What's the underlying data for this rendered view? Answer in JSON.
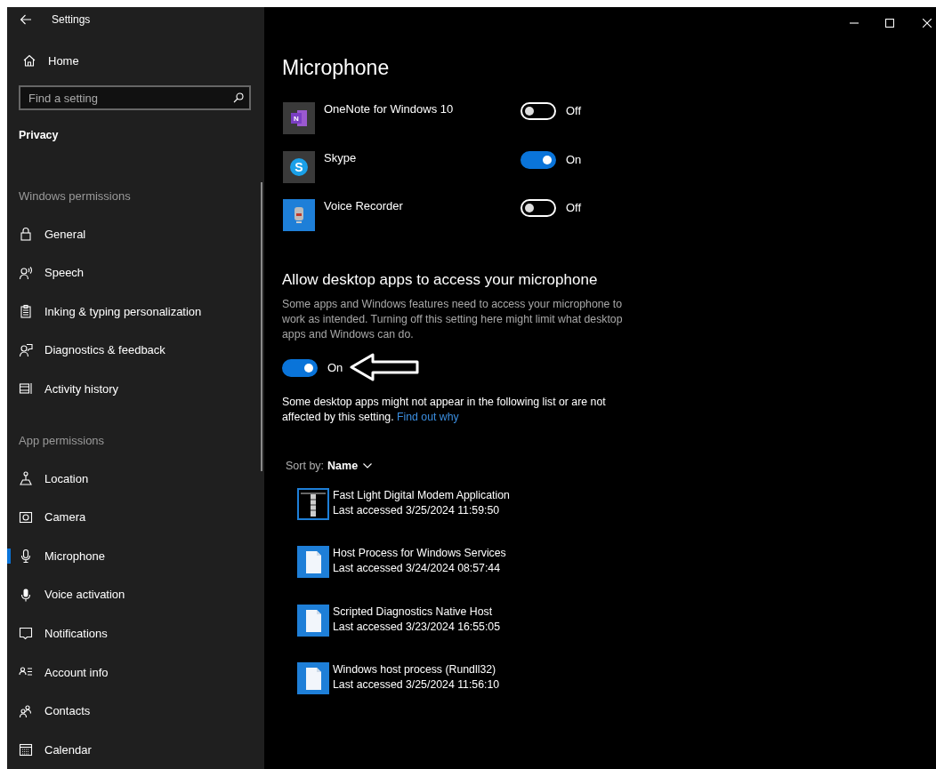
{
  "window": {
    "title": "Settings"
  },
  "sidebar": {
    "home": "Home",
    "search": {
      "placeholder": "Find a setting"
    },
    "section": "Privacy",
    "groups": [
      {
        "heading": "Windows permissions",
        "items": [
          {
            "label": "General",
            "selected": false
          },
          {
            "label": "Speech",
            "selected": false
          },
          {
            "label": "Inking & typing personalization",
            "selected": false
          },
          {
            "label": "Diagnostics & feedback",
            "selected": false
          },
          {
            "label": "Activity history",
            "selected": false
          }
        ]
      },
      {
        "heading": "App permissions",
        "items": [
          {
            "label": "Location",
            "selected": false
          },
          {
            "label": "Camera",
            "selected": false
          },
          {
            "label": "Microphone",
            "selected": true
          },
          {
            "label": "Voice activation",
            "selected": false
          },
          {
            "label": "Notifications",
            "selected": false
          },
          {
            "label": "Account info",
            "selected": false
          },
          {
            "label": "Contacts",
            "selected": false
          },
          {
            "label": "Calendar",
            "selected": false
          }
        ]
      }
    ]
  },
  "page": {
    "title": "Microphone",
    "apps": [
      {
        "name": "OneNote for Windows 10",
        "icon_letter": "N",
        "on": false,
        "state": "Off"
      },
      {
        "name": "Skype",
        "icon_letter": "S",
        "on": true,
        "state": "On"
      },
      {
        "name": "Voice Recorder",
        "on": false,
        "state": "Off"
      }
    ],
    "desktop_access": {
      "heading": "Allow desktop apps to access your microphone",
      "description": "Some apps and Windows features need to access your microphone to work as intended. Turning off this setting here might limit what desktop apps and Windows can do.",
      "on": true,
      "state": "On",
      "note": "Some desktop apps might not appear in the following list or are not affected by this setting.",
      "link": "Find out why"
    },
    "sort": {
      "label": "Sort by:",
      "value": "Name"
    },
    "desktop_apps": [
      {
        "name": "Fast Light Digital Modem Application",
        "last_accessed": "Last accessed 3/25/2024 11:59:50"
      },
      {
        "name": "Host Process for Windows Services",
        "last_accessed": "Last accessed 3/24/2024 08:57:44"
      },
      {
        "name": "Scripted Diagnostics Native Host",
        "last_accessed": "Last accessed 3/23/2024 16:55:05"
      },
      {
        "name": "Windows host process (Rundll32)",
        "last_accessed": "Last accessed 3/25/2024 11:56:10"
      }
    ]
  }
}
